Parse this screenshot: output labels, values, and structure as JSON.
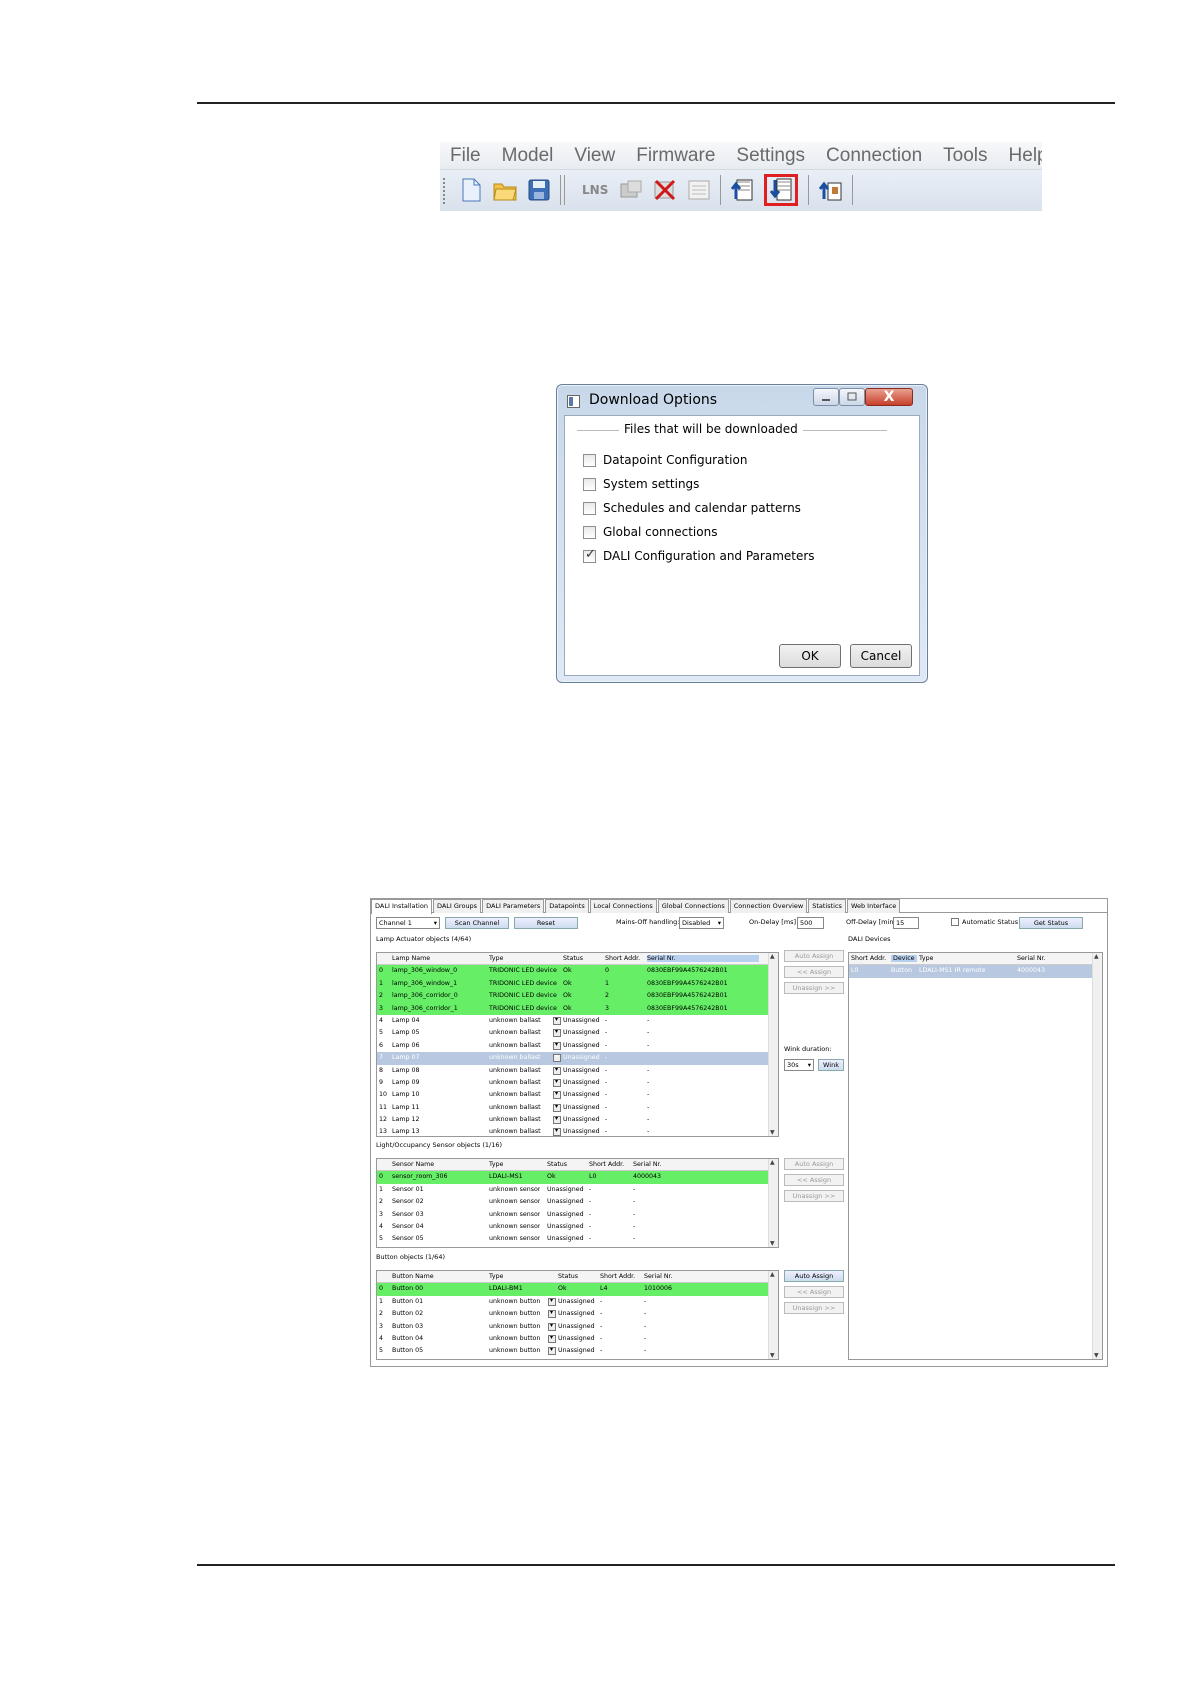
{
  "menubar": {
    "items": [
      "File",
      "Model",
      "View",
      "Firmware",
      "Settings",
      "Connection",
      "Tools",
      "Help"
    ]
  },
  "toolbar": {
    "icons": [
      "new-file-icon",
      "open-folder-icon",
      "save-icon",
      "lns-icon",
      "device-icon",
      "delete-icon",
      "list-icon",
      "upload-icon",
      "download-icon",
      "download-parameters-icon"
    ],
    "lns_label": "LNS",
    "highlight_color": "#e02020"
  },
  "download_dialog": {
    "title": "Download Options",
    "group_title": "Files that will be downloaded",
    "options": [
      {
        "label": "Datapoint Configuration",
        "checked": false
      },
      {
        "label": "System settings",
        "checked": false
      },
      {
        "label": "Schedules and calendar patterns",
        "checked": false
      },
      {
        "label": "Global connections",
        "checked": false
      },
      {
        "label": "DALI Configuration and Parameters",
        "checked": true
      }
    ],
    "ok_label": "OK",
    "cancel_label": "Cancel",
    "close_glyph": "X"
  },
  "dali": {
    "tabs": [
      "DALI Installation",
      "DALI Groups",
      "DALI Parameters",
      "Datapoints",
      "Local Connections",
      "Global Connections",
      "Connection Overview",
      "Statistics",
      "Web Interface"
    ],
    "channel": "Channel 1",
    "scan_channel": "Scan Channel",
    "reset": "Reset",
    "mains_off_label": "Mains-Off handling:",
    "mains_off_value": "Disabled",
    "on_delay_label": "On-Delay [ms]",
    "on_delay_value": "500",
    "off_delay_label": "Off-Delay [min]",
    "off_delay_value": "15",
    "automatic_status": "Automatic Status",
    "get_status": "Get Status",
    "lamp_section": "Lamp Actuator objects (4/64)",
    "lamp_headers": [
      "Lamp Name",
      "Type",
      "Status",
      "Short Addr.",
      "Serial Nr."
    ],
    "lamps": [
      [
        "0",
        "lamp_306_window_0",
        "TRIDONIC LED device",
        "Ok",
        "0",
        "0830EBF99A4576242B01",
        "g"
      ],
      [
        "1",
        "lamp_306_window_1",
        "TRIDONIC LED device",
        "Ok",
        "1",
        "0830EBF99A4576242B01",
        "g"
      ],
      [
        "2",
        "lamp_306_corridor_0",
        "TRIDONIC LED device",
        "Ok",
        "2",
        "0830EBF99A4576242B01",
        "g"
      ],
      [
        "3",
        "lamp_306_corridor_1",
        "TRIDONIC LED device",
        "Ok",
        "3",
        "0830EBF99A4576242B01",
        "g"
      ],
      [
        "4",
        "Lamp 04",
        "unknown ballast",
        "Unassigned",
        "-",
        "-",
        ""
      ],
      [
        "5",
        "Lamp 05",
        "unknown ballast",
        "Unassigned",
        "-",
        "-",
        ""
      ],
      [
        "6",
        "Lamp 06",
        "unknown ballast",
        "Unassigned",
        "-",
        "-",
        ""
      ],
      [
        "7",
        "Lamp 07",
        "unknown ballast",
        "Unassigned",
        "-",
        "",
        ""
      ],
      [
        "8",
        "Lamp 08",
        "unknown ballast",
        "Unassigned",
        "-",
        "-",
        ""
      ],
      [
        "9",
        "Lamp 09",
        "unknown ballast",
        "Unassigned",
        "-",
        "-",
        ""
      ],
      [
        "10",
        "Lamp 10",
        "unknown ballast",
        "Unassigned",
        "-",
        "-",
        ""
      ],
      [
        "11",
        "Lamp 11",
        "unknown ballast",
        "Unassigned",
        "-",
        "-",
        ""
      ],
      [
        "12",
        "Lamp 12",
        "unknown ballast",
        "Unassigned",
        "-",
        "-",
        ""
      ],
      [
        "13",
        "Lamp 13",
        "unknown ballast",
        "Unassigned",
        "-",
        "-",
        ""
      ]
    ],
    "auto_assign": "Auto Assign",
    "assign": "<< Assign",
    "unassign": "Unassign >>",
    "wink_duration_label": "Wink duration:",
    "wink_duration_value": "30s",
    "wink": "Wink",
    "sensor_section": "Light/Occupancy Sensor objects (1/16)",
    "sensor_headers": [
      "Sensor Name",
      "Type",
      "Status",
      "Short Addr.",
      "Serial Nr."
    ],
    "sensors": [
      [
        "0",
        "sensor_room_306",
        "LDALI-MS1",
        "Ok",
        "L0",
        "4000043",
        "g"
      ],
      [
        "1",
        "Sensor 01",
        "unknown sensor",
        "Unassigned",
        "-",
        "-",
        ""
      ],
      [
        "2",
        "Sensor 02",
        "unknown sensor",
        "Unassigned",
        "-",
        "-",
        ""
      ],
      [
        "3",
        "Sensor 03",
        "unknown sensor",
        "Unassigned",
        "-",
        "-",
        ""
      ],
      [
        "4",
        "Sensor 04",
        "unknown sensor",
        "Unassigned",
        "-",
        "-",
        ""
      ],
      [
        "5",
        "Sensor 05",
        "unknown sensor",
        "Unassigned",
        "-",
        "-",
        ""
      ]
    ],
    "button_section": "Button objects (1/64)",
    "button_headers": [
      "Button Name",
      "Type",
      "Status",
      "Short Addr.",
      "Serial Nr."
    ],
    "buttons": [
      [
        "0",
        "Button 00",
        "LDALI-BM1",
        "Ok",
        "L4",
        "1010006",
        "g"
      ],
      [
        "1",
        "Button 01",
        "unknown button",
        "Unassigned",
        "-",
        "-",
        ""
      ],
      [
        "2",
        "Button 02",
        "unknown button",
        "Unassigned",
        "-",
        "-",
        ""
      ],
      [
        "3",
        "Button 03",
        "unknown button",
        "Unassigned",
        "-",
        "-",
        ""
      ],
      [
        "4",
        "Button 04",
        "unknown button",
        "Unassigned",
        "-",
        "-",
        ""
      ],
      [
        "5",
        "Button 05",
        "unknown button",
        "Unassigned",
        "-",
        "-",
        ""
      ]
    ],
    "devices_section": "DALI Devices",
    "device_headers": [
      "Short Addr.",
      "Device",
      "Type",
      "Serial Nr."
    ],
    "devices": [
      [
        "L0",
        "Button",
        "LDALI-MS1 IR remote",
        "4000043"
      ]
    ]
  }
}
